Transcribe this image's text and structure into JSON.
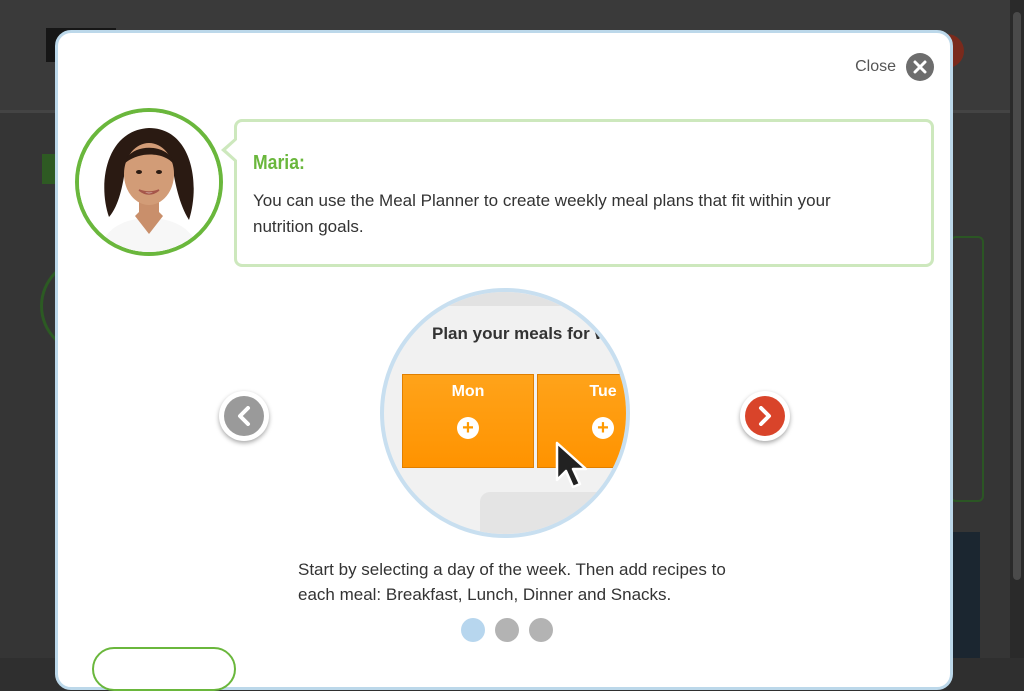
{
  "modal": {
    "close_label": "Close",
    "speaker": "Maria:",
    "message": "You can use the Meal Planner to create weekly meal plans that fit within your nutrition goals.",
    "caption": "Start by selecting a day of the week. Then add recipes to each meal: Breakfast, Lunch, Dinner and Snacks."
  },
  "illustration": {
    "title": "Plan your meals for w",
    "days": [
      "Mon",
      "Tue"
    ]
  },
  "pagination": {
    "total": 3,
    "active_index": 0
  },
  "colors": {
    "brand_green": "#6ab73c",
    "accent_orange": "#ff9a00",
    "next_red": "#d9442a",
    "prev_gray": "#9a9a9a",
    "active_dot": "#b7d6ee"
  }
}
